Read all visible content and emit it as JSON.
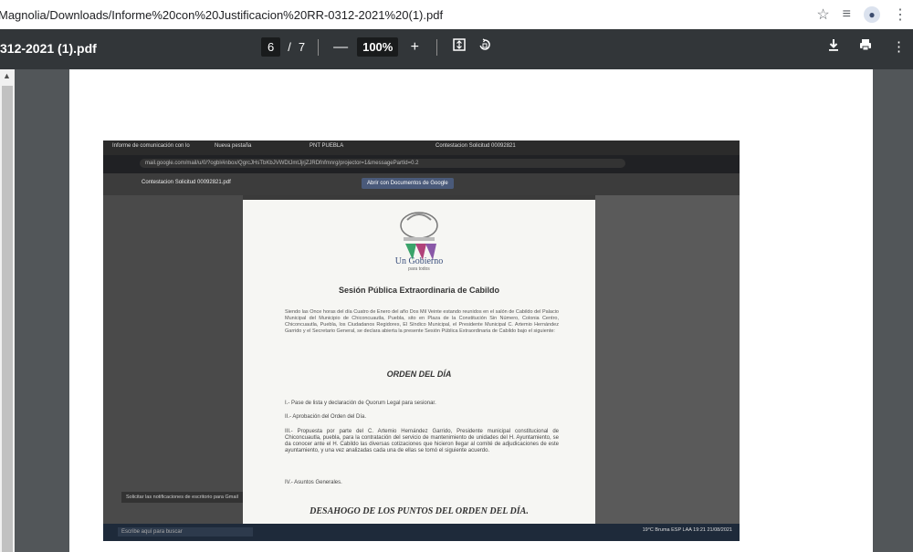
{
  "browser": {
    "url": "Magnolia/Downloads/Informe%20con%20Justificacion%20RR-0312-2021%20(1).pdf",
    "star_icon": "star-icon",
    "extension_icon": "reading-list-icon",
    "profile_icon": "avatar",
    "menu_icon": "more-vert-icon"
  },
  "pdf_toolbar": {
    "title": "312-2021 (1).pdf",
    "page_current": "6",
    "page_sep": "/",
    "page_total": "7",
    "zoom_minus": "—",
    "zoom": "100%",
    "zoom_plus": "+",
    "fit_icon": "fit-page-icon",
    "rotate_icon": "rotate-icon",
    "download_icon": "download-icon",
    "print_icon": "print-icon",
    "menu_icon": "more-vert-icon"
  },
  "scanned_photo": {
    "tab1": "Informe de comunicación con lo",
    "tab2": "Nueva pestaña",
    "tab3": "PNT PUEBLA",
    "tab4": "Contestacion Solicitud 00092821",
    "url": "mail.google.com/mail/u/0/?ogbl#inbox/QgrcJHsTbKbJVWDtJmtJjrjZJRDfnfmnrg/projector=1&messagePartId=0.2",
    "file_name": "Contestacion Solicitud 00092821.pdf",
    "open_with": "Abrir con Documentos de Google",
    "logo_text": "CHICONCUAUTLA",
    "gobierno": "Un Gobierno",
    "gobierno_sub": "para todos",
    "title": "Sesión Pública Extraordinaria de Cabildo",
    "paragraph": "Siendo las Once horas del día Cuatro de Enero del año Dos Mil Veinte estando reunidos en el salón de Cabildo del Palacio Municipal del Municipio de Chiconcuautla, Puebla, sito en Plaza de la Constitución Sin Número, Colonia Centro, Chiconcuautla, Puebla, los Ciudadanos Regidores, El Síndico Municipal, el Presidente Municipal C. Artemio Hernández Garrido y el Secretario General, se declara abierta la presente Sesión Pública Extraordinaria de Cabildo bajo el siguiente:",
    "orden": "ORDEN DEL DÍA",
    "item1": "I.- Pase de lista y declaración de Quorum Legal para sesionar.",
    "item2": "II.- Aprobación del Orden del Día.",
    "item3": "III.- Propuesta por parte del C. Artemio Hernández Garrido, Presidente municipal constitucional de Chiconcuautla, puebla, para la contratación del servicio de mantenimiento de unidades del H. Ayuntamiento, se da conocer ante el H. Cabildo las diversas cotizaciones que hicieron llegar al comité de adjudicaciones de este ayuntamiento, y una vez analizadas cada una de ellas se tomó el siguiente acuerdo.",
    "item4": "IV.- Asuntos Generales.",
    "desahogo": "DESAHOGO DE LOS PUNTOS DEL ORDEN DEL DÍA.",
    "taskbar_search": "Escribe aquí para buscar",
    "tray": "19°C Bruma   ESP LAA   19:21 21/08/2021",
    "notif": "Solicitar las notificaciones de escritorio para Gmail"
  },
  "colors": {
    "toolbar_bg": "#323639",
    "viewer_bg": "#525659",
    "page_bg": "#ffffff",
    "accent_logo": "#3a4f7c"
  }
}
